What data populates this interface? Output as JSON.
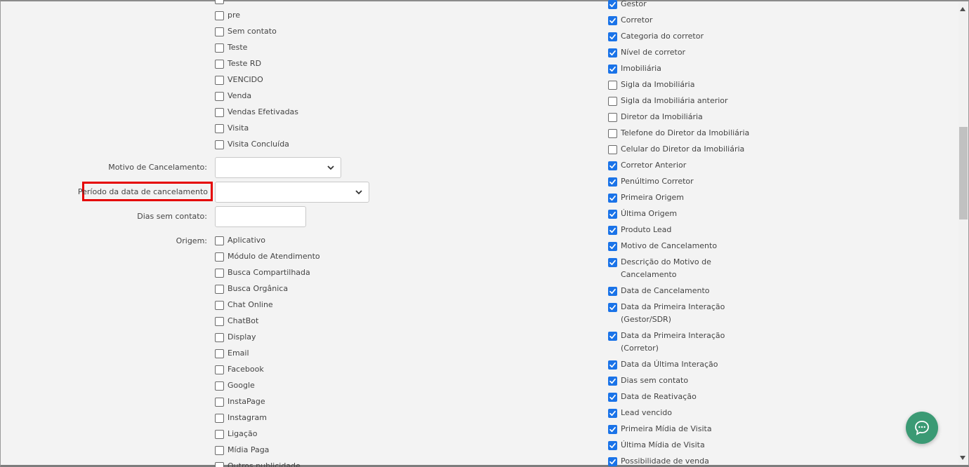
{
  "left_checkboxes_top": [
    {
      "label": "",
      "checked": false
    },
    {
      "label": "pre",
      "checked": false
    },
    {
      "label": "Sem contato",
      "checked": false
    },
    {
      "label": "Teste",
      "checked": false
    },
    {
      "label": "Teste RD",
      "checked": false
    },
    {
      "label": "VENCIDO",
      "checked": false
    },
    {
      "label": "Venda",
      "checked": false
    },
    {
      "label": "Vendas Efetivadas",
      "checked": false
    },
    {
      "label": "Visita",
      "checked": false
    },
    {
      "label": "Visita Concluída",
      "checked": false
    }
  ],
  "form": {
    "motivo_label": "Motivo de Cancelamento:",
    "motivo_value": "",
    "periodo_label": "Período da data de cancelamento",
    "periodo_value": "",
    "dias_label": "Dias sem contato:",
    "dias_value": "",
    "origem_label": "Origem:"
  },
  "origem_checkboxes": [
    {
      "label": "Aplicativo",
      "checked": false
    },
    {
      "label": "Módulo de Atendimento",
      "checked": false
    },
    {
      "label": "Busca Compartilhada",
      "checked": false
    },
    {
      "label": "Busca Orgânica",
      "checked": false
    },
    {
      "label": "Chat Online",
      "checked": false
    },
    {
      "label": "ChatBot",
      "checked": false
    },
    {
      "label": "Display",
      "checked": false
    },
    {
      "label": "Email",
      "checked": false
    },
    {
      "label": "Facebook",
      "checked": false
    },
    {
      "label": "Google",
      "checked": false
    },
    {
      "label": "InstaPage",
      "checked": false
    },
    {
      "label": "Instagram",
      "checked": false
    },
    {
      "label": "Ligação",
      "checked": false
    },
    {
      "label": "Mídia Paga",
      "checked": false
    },
    {
      "label": "Outros publicidade",
      "checked": false
    }
  ],
  "right_checkboxes": [
    {
      "label": "Gestor",
      "checked": true
    },
    {
      "label": "Corretor",
      "checked": true
    },
    {
      "label": "Categoria do corretor",
      "checked": true
    },
    {
      "label": "Nível de corretor",
      "checked": true
    },
    {
      "label": "Imobiliária",
      "checked": true
    },
    {
      "label": "Sigla da Imobiliária",
      "checked": false
    },
    {
      "label": "Sigla da Imobiliária anterior",
      "checked": false
    },
    {
      "label": "Diretor da Imobiliária",
      "checked": false
    },
    {
      "label": "Telefone do Diretor da Imobiliária",
      "checked": false
    },
    {
      "label": "Celular do Diretor da Imobiliária",
      "checked": false
    },
    {
      "label": "Corretor Anterior",
      "checked": true
    },
    {
      "label": "Penúltimo Corretor",
      "checked": true
    },
    {
      "label": "Primeira Origem",
      "checked": true
    },
    {
      "label": "Última Origem",
      "checked": true
    },
    {
      "label": "Produto Lead",
      "checked": true
    },
    {
      "label": "Motivo de Cancelamento",
      "checked": true
    },
    {
      "label": "Descrição do Motivo de",
      "label2": "Cancelamento",
      "checked": true
    },
    {
      "label": "Data de Cancelamento",
      "checked": true
    },
    {
      "label": "Data da Primeira Interação",
      "label2": "(Gestor/SDR)",
      "checked": true
    },
    {
      "label": "Data da Primeira Interação",
      "label2": "(Corretor)",
      "checked": true
    },
    {
      "label": "Data da Última Interação",
      "checked": true
    },
    {
      "label": "Dias sem contato",
      "checked": true
    },
    {
      "label": "Data de Reativação",
      "checked": true
    },
    {
      "label": "Lead vencido",
      "checked": true
    },
    {
      "label": "Primeira Mídia de Visita",
      "checked": true
    },
    {
      "label": "Última Mídia de Visita",
      "checked": true
    },
    {
      "label": "Possibilidade de venda",
      "checked": true
    }
  ],
  "colors": {
    "checkbox_checked": "#1a73e8",
    "highlight": "#e50000",
    "chat_button": "#3b9a74"
  },
  "icons": {
    "select_arrow": "chevron-down-icon",
    "chat": "chat-bubble-icon",
    "scroll_up": "caret-up-icon",
    "scroll_down": "caret-down-icon"
  }
}
